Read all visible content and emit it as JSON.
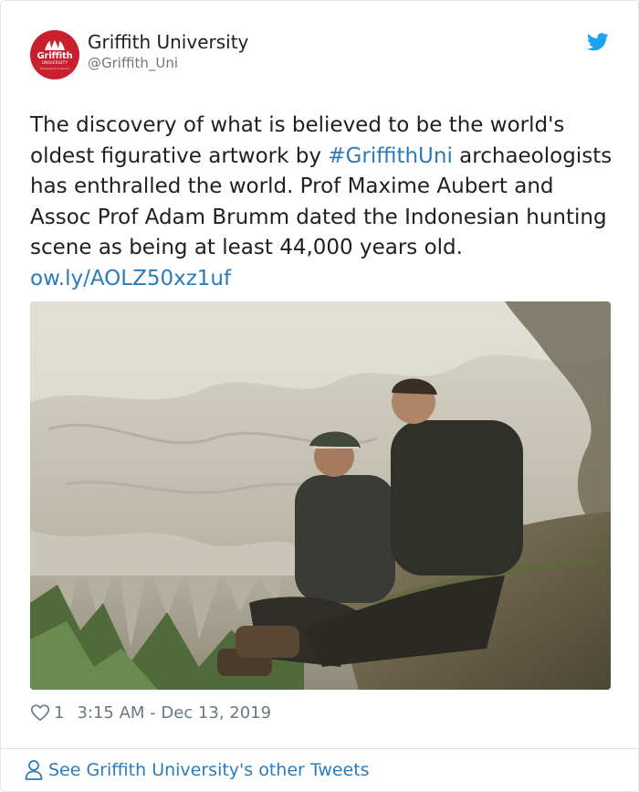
{
  "author": {
    "display_name": "Griffith University",
    "handle": "@Griffith_Uni",
    "avatar_logo_text": "Griffith",
    "avatar_logo_sub": "UNIVERSITY",
    "avatar_logo_tiny": "Queensland Australia"
  },
  "tweet": {
    "text_part1": "The discovery of what is believed to be the world's oldest figurative artwork by ",
    "hashtag": "#GriffithUni",
    "text_part2": " archaeologists has enthralled the world. Prof Maxime Aubert and Assoc Prof Adam Brumm dated the Indonesian hunting scene as being at least 44,000 years old. ",
    "link": "ow.ly/AOLZ50xz1uf"
  },
  "meta": {
    "like_count": "1",
    "timestamp": "3:15 AM - Dec 13, 2019"
  },
  "footer": {
    "more_tweets_label": "See Griffith University's other Tweets"
  },
  "icons": {
    "brand": "twitter-bird-icon",
    "like": "heart-icon",
    "profile": "person-icon"
  },
  "colors": {
    "link": "#2b7bb9",
    "twitter_blue": "#1da1f2",
    "avatar_red": "#c8202f",
    "muted": "#697882"
  }
}
